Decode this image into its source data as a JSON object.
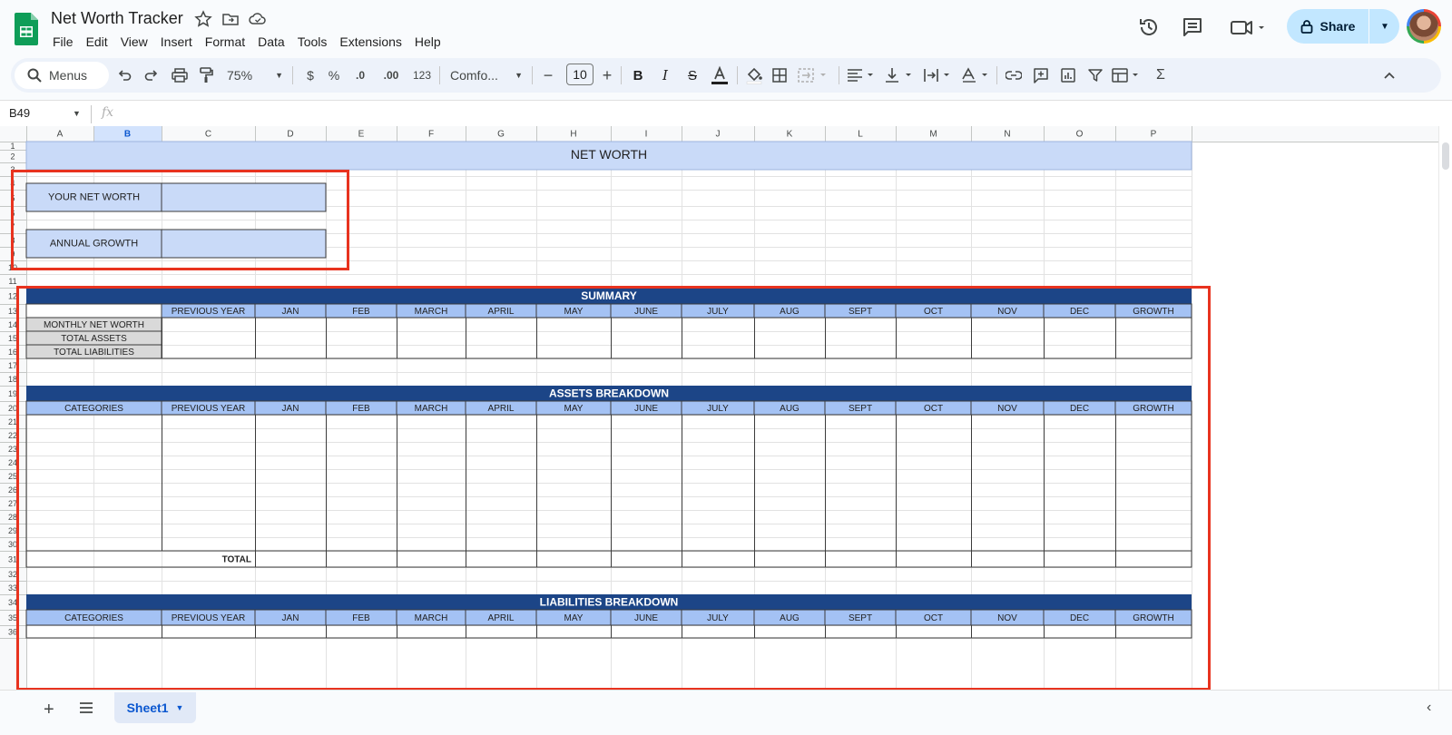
{
  "app": {
    "title": "Net Worth Tracker",
    "menu": [
      "File",
      "Edit",
      "View",
      "Insert",
      "Format",
      "Data",
      "Tools",
      "Extensions",
      "Help"
    ],
    "share_label": "Share"
  },
  "toolbar": {
    "menus_label": "Menus",
    "zoom": "75%",
    "currency": "$",
    "percent": "%",
    "decimal_decrease": ".0",
    "decimal_increase": ".00",
    "number_format": "123",
    "font_name": "Comfo...",
    "font_size": "10",
    "minus": "−",
    "plus": "+"
  },
  "formula_bar": {
    "cell_ref": "B49",
    "fx": "fx"
  },
  "sheet": {
    "columns": [
      "A",
      "B",
      "C",
      "D",
      "E",
      "F",
      "G",
      "H",
      "I",
      "J",
      "K",
      "L",
      "M",
      "N",
      "O",
      "P"
    ],
    "rows": [
      "1",
      "2",
      "3",
      "4",
      "5",
      "6",
      "7",
      "8",
      "9",
      "10",
      "11",
      "12",
      "13",
      "14",
      "15",
      "16",
      "17",
      "18",
      "19",
      "20",
      "21",
      "22",
      "23",
      "24",
      "25",
      "26",
      "27",
      "28",
      "29",
      "30",
      "31",
      "32",
      "33",
      "34",
      "35",
      "36"
    ],
    "title": "NET WORTH",
    "your_net_worth_label": "YOUR NET WORTH",
    "annual_growth_label": "ANNUAL GROWTH",
    "summary_title": "SUMMARY",
    "summary_header": [
      "PREVIOUS YEAR",
      "JAN",
      "FEB",
      "MARCH",
      "APRIL",
      "MAY",
      "JUNE",
      "JULY",
      "AUG",
      "SEPT",
      "OCT",
      "NOV",
      "DEC",
      "GROWTH"
    ],
    "summary_rows": [
      "MONTHLY NET WORTH",
      "TOTAL ASSETS",
      "TOTAL LIABILITIES"
    ],
    "assets_title": "ASSETS BREAKDOWN",
    "liabilities_title": "LIABILITIES BREAKDOWN",
    "breakdown_header": [
      "CATEGORIES",
      "PREVIOUS YEAR",
      "JAN",
      "FEB",
      "MARCH",
      "APRIL",
      "MAY",
      "JUNE",
      "JULY",
      "AUG",
      "SEPT",
      "OCT",
      "NOV",
      "DEC",
      "GROWTH"
    ],
    "total_label": "TOTAL"
  },
  "bottom": {
    "sheet_tab": "Sheet1"
  },
  "colors": {
    "light_blue": "#c9daf8",
    "header_blue": "#a4c2f4",
    "dark_blue": "#1c4587",
    "gray_label": "#d9d9d9",
    "highlight": "#e8331f"
  }
}
